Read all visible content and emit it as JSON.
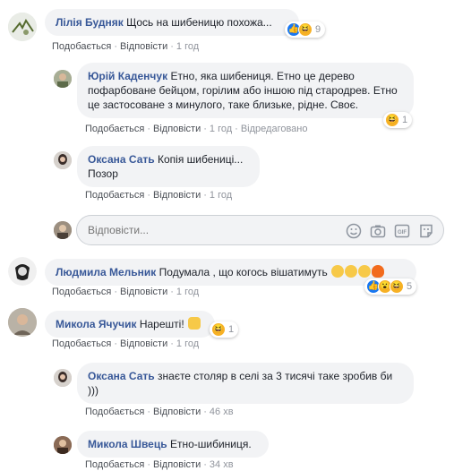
{
  "comments": [
    {
      "author": "Лілія Будняк",
      "text": "Щось на шибеницю похожа...",
      "reaction_count": "9",
      "actions": {
        "like": "Подобається",
        "reply": "Відповісти",
        "time": "1 год"
      }
    },
    {
      "author": "Юрій Каденчук",
      "text": "Етно, яка шибениця. Етно це дерево пофарбоване бейцом, горілим або іншою під стародрев. Етно це застосоване з минулого, таке близьке, рідне. Своє.",
      "reaction_count": "1",
      "actions": {
        "like": "Подобається",
        "reply": "Відповісти",
        "time": "1 год",
        "edited": "Відредаговано"
      }
    },
    {
      "author": "Оксана Сать",
      "text": "Копія шибениці...",
      "text2": "Позор",
      "actions": {
        "like": "Подобається",
        "reply": "Відповісти",
        "time": "1 год"
      }
    },
    {
      "author": "Людмила Мельник",
      "text": "Подумала , що когось вішатимуть",
      "reaction_count": "5",
      "actions": {
        "like": "Подобається",
        "reply": "Відповісти",
        "time": "1 год"
      }
    },
    {
      "author": "Микола Ячучик",
      "text": "Нарешті!",
      "reaction_count": "1",
      "actions": {
        "like": "Подобається",
        "reply": "Відповісти",
        "time": "1 год"
      }
    },
    {
      "author": "Оксана Сать",
      "text": "знаєте столяр в селі за 3 тисячі таке зробив би )))",
      "actions": {
        "like": "Подобається",
        "reply": "Відповісти",
        "time": "46 хв"
      }
    },
    {
      "author": "Микола Швець",
      "text": "Етно-шибиниця.",
      "actions": {
        "like": "Подобається",
        "reply": "Відповісти",
        "time": "34 хв"
      }
    }
  ],
  "reply_box": {
    "placeholder": "Відповісти..."
  },
  "colors": {
    "author": "#385898",
    "bubble": "#f2f3f5",
    "meta": "#90949c",
    "like_blue": "#1877f2",
    "haha_yellow": "#f7b125"
  },
  "icons": [
    "smile-icon",
    "camera-icon",
    "gif-icon",
    "sticker-icon"
  ]
}
